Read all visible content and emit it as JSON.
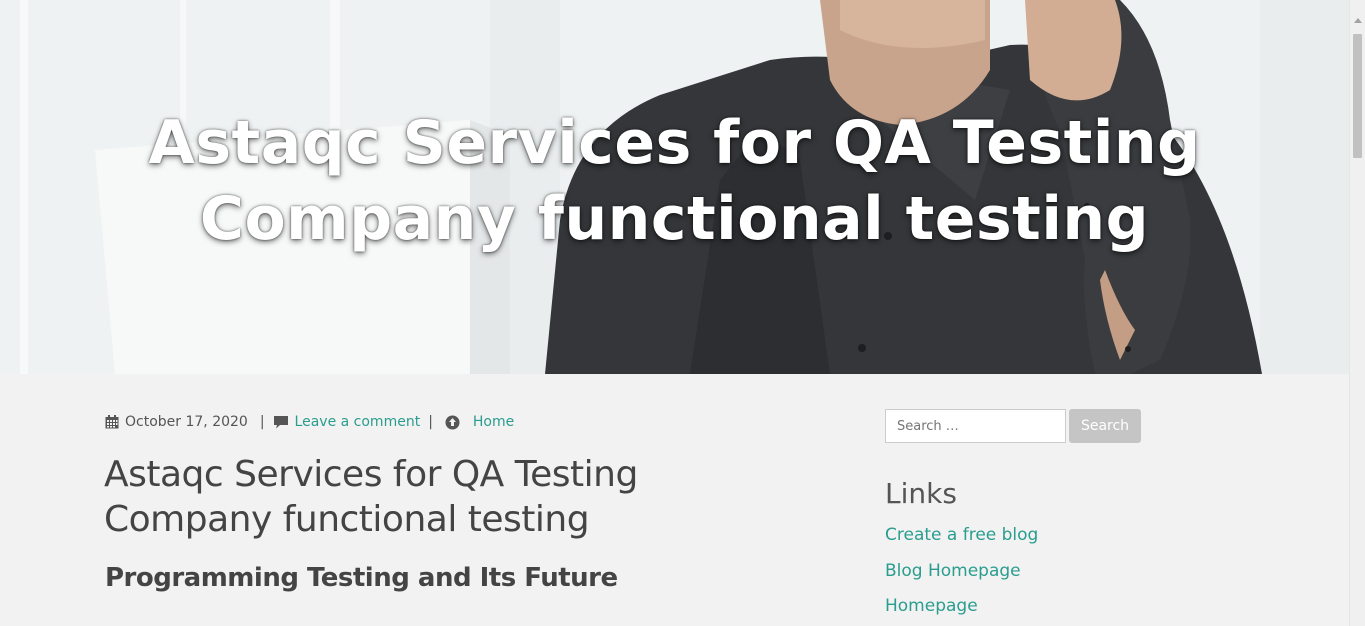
{
  "hero": {
    "title_line1": "Astaqc Services for QA Testing",
    "title_line2": "Company functional testing"
  },
  "post": {
    "date": "October 17, 2020",
    "separator": "|",
    "comment_link": "Leave a comment",
    "category_link": "Home",
    "title": "Astaqc Services for QA Testing Company functional testing",
    "subtitle": "Programming Testing and Its Future"
  },
  "sidebar": {
    "search": {
      "placeholder": "Search …",
      "button_label": "Search"
    },
    "links": {
      "heading": "Links",
      "items": [
        {
          "label": "Create a free blog"
        },
        {
          "label": "Blog Homepage"
        },
        {
          "label": "Homepage"
        }
      ]
    }
  },
  "colors": {
    "accent": "#2a9d8f",
    "text": "#444444",
    "page_background": "#f2f2f2",
    "search_button": "#c5c5c5"
  },
  "icons": {
    "date": "calendar-icon",
    "comment": "comment-icon",
    "category": "arrow-circle-up-icon"
  }
}
